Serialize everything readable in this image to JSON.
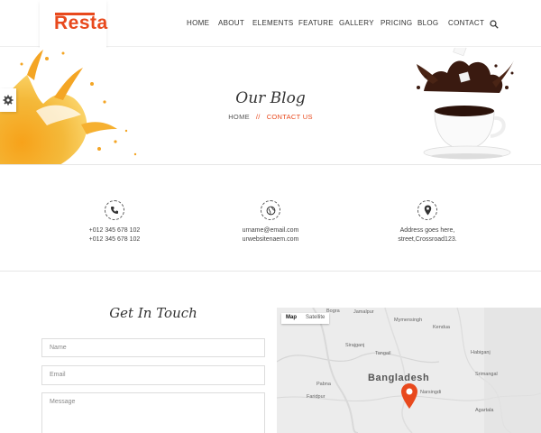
{
  "header": {
    "logo": "Resta",
    "nav": [
      "HOME",
      "ABOUT",
      "ELEMENTS",
      "FEATURE",
      "GALLERY",
      "PRICING",
      "BLOG",
      "CONTACT"
    ],
    "search_icon": "search-icon"
  },
  "banner": {
    "title": "Our Blog",
    "breadcrumb": {
      "home": "HOME",
      "separator": "//",
      "current": "CONTACT US"
    },
    "settings_icon": "gear-icon"
  },
  "contact_info": [
    {
      "icon": "phone-icon",
      "lines": [
        "+012 345 678 102",
        "+012 345 678 102"
      ]
    },
    {
      "icon": "globe-icon",
      "lines": [
        "urname@email.com",
        "urwebsitenaem.com"
      ]
    },
    {
      "icon": "map-pin-icon",
      "lines": [
        "Address goes here,",
        "street,Crossroad123."
      ]
    }
  ],
  "contact_form": {
    "title": "Get In Touch",
    "name_placeholder": "Name",
    "email_placeholder": "Email",
    "message_placeholder": "Message"
  },
  "map": {
    "tabs": [
      "Map",
      "Satellite"
    ],
    "country": "Bangladesh",
    "places": [
      "Bogra",
      "Jamalpur",
      "Mymensingh",
      "Kendua",
      "Sirajganj",
      "Tangail",
      "Habiganj",
      "Pabna",
      "Narsingdi",
      "Agartala",
      "Srimangal",
      "Faridpur"
    ]
  },
  "colors": {
    "accent": "#e8491d"
  }
}
